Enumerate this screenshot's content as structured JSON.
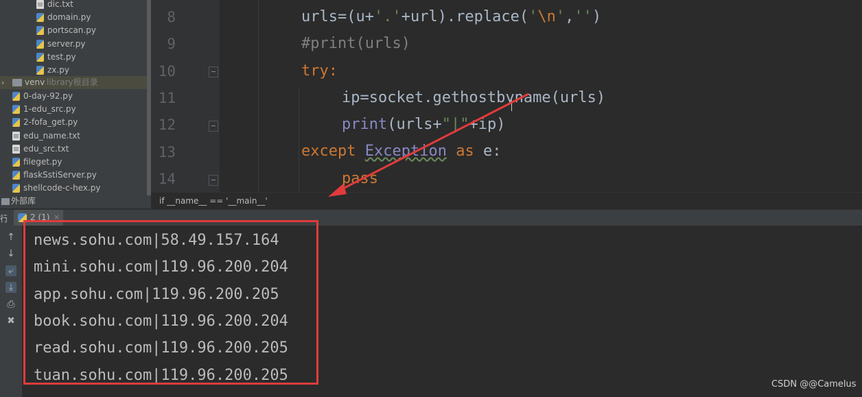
{
  "tree": {
    "indented_files": [
      {
        "name": "dic.txt",
        "kind": "txt"
      },
      {
        "name": "domain.py",
        "kind": "py"
      },
      {
        "name": "portscan.py",
        "kind": "py"
      },
      {
        "name": "server.py",
        "kind": "py"
      },
      {
        "name": "test.py",
        "kind": "py"
      },
      {
        "name": "zx.py",
        "kind": "py"
      }
    ],
    "venv": {
      "name": "venv",
      "hint": "library根目录"
    },
    "files": [
      {
        "name": "0-day-92.py",
        "kind": "py"
      },
      {
        "name": "1-edu_src.py",
        "kind": "py"
      },
      {
        "name": "2-fofa_get.py",
        "kind": "py"
      },
      {
        "name": "edu_name.txt",
        "kind": "txt"
      },
      {
        "name": "edu_src.txt",
        "kind": "txt"
      },
      {
        "name": "fileget.py",
        "kind": "py"
      },
      {
        "name": "flaskSstiServer.py",
        "kind": "py"
      },
      {
        "name": "shellcode-c-hex.py",
        "kind": "py"
      }
    ],
    "external": "外部库"
  },
  "editor": {
    "line_numbers": [
      "8",
      "9",
      "10",
      "11",
      "12",
      "13",
      "14"
    ],
    "breadcrumb": "if __name__ == '__main__'"
  },
  "run": {
    "label": "行:",
    "tab_label": "2 (1)",
    "output": [
      "news.sohu.com|58.49.157.164",
      "mini.sohu.com|119.96.200.204",
      "app.sohu.com|119.96.200.205",
      "book.sohu.com|119.96.200.204",
      "read.sohu.com|119.96.200.205",
      "tuan.sohu.com|119.96.200.205"
    ]
  },
  "watermark": "CSDN @@Camelus",
  "colors": {
    "annotation": "#e23b3b",
    "keyword": "#cc7832",
    "string": "#6a8759"
  }
}
